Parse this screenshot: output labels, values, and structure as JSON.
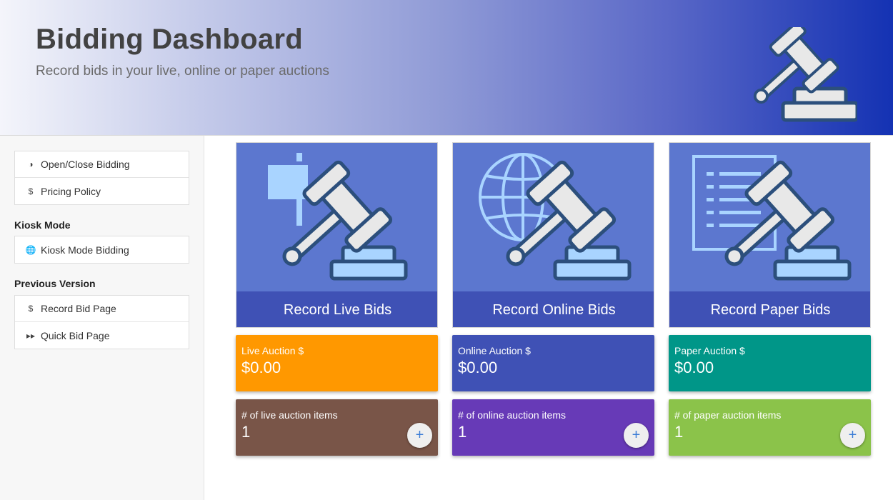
{
  "header": {
    "title": "Bidding Dashboard",
    "subtitle": "Record bids in your live, online or paper auctions",
    "icon": "gavel-icon"
  },
  "sidebar": {
    "group1": [
      {
        "icon": "half-circle-icon",
        "glyph": "◑",
        "label": "Open/Close Bidding"
      },
      {
        "icon": "dollar-icon",
        "glyph": "$",
        "label": "Pricing Policy"
      }
    ],
    "kiosk_heading": "Kiosk Mode",
    "kiosk": [
      {
        "icon": "globe-icon",
        "glyph": "🌐",
        "label": "Kiosk Mode Bidding"
      }
    ],
    "previous_heading": "Previous Version",
    "previous": [
      {
        "icon": "dollar-icon",
        "glyph": "$",
        "label": "Record Bid Page"
      },
      {
        "icon": "fast-forward-icon",
        "glyph": "▸▸",
        "label": "Quick Bid Page"
      }
    ]
  },
  "cards": [
    {
      "label": "Record Live Bids",
      "icon": "gavel-sign-icon"
    },
    {
      "label": "Record Online Bids",
      "icon": "gavel-globe-icon"
    },
    {
      "label": "Record Paper Bids",
      "icon": "gavel-document-icon"
    }
  ],
  "totals": [
    {
      "label": "Live Auction $",
      "value": "$0.00",
      "color": "#ff9800"
    },
    {
      "label": "Online Auction $",
      "value": "$0.00",
      "color": "#3f51b5"
    },
    {
      "label": "Paper Auction $",
      "value": "$0.00",
      "color": "#009688"
    }
  ],
  "counts": [
    {
      "label": "# of live auction items",
      "value": "1",
      "color": "#795548",
      "add": "+"
    },
    {
      "label": "# of online auction items",
      "value": "1",
      "color": "#673ab7",
      "add": "+"
    },
    {
      "label": "# of paper auction items",
      "value": "1",
      "color": "#8bc34a",
      "add": "+"
    }
  ],
  "colors": {
    "card_bg": "#5c77cf",
    "card_label_bg": "#3f51b5",
    "gavel_outline": "#2c4f7c",
    "gavel_fill": "#e8e8e8",
    "accent_light": "#a9d4ff"
  }
}
